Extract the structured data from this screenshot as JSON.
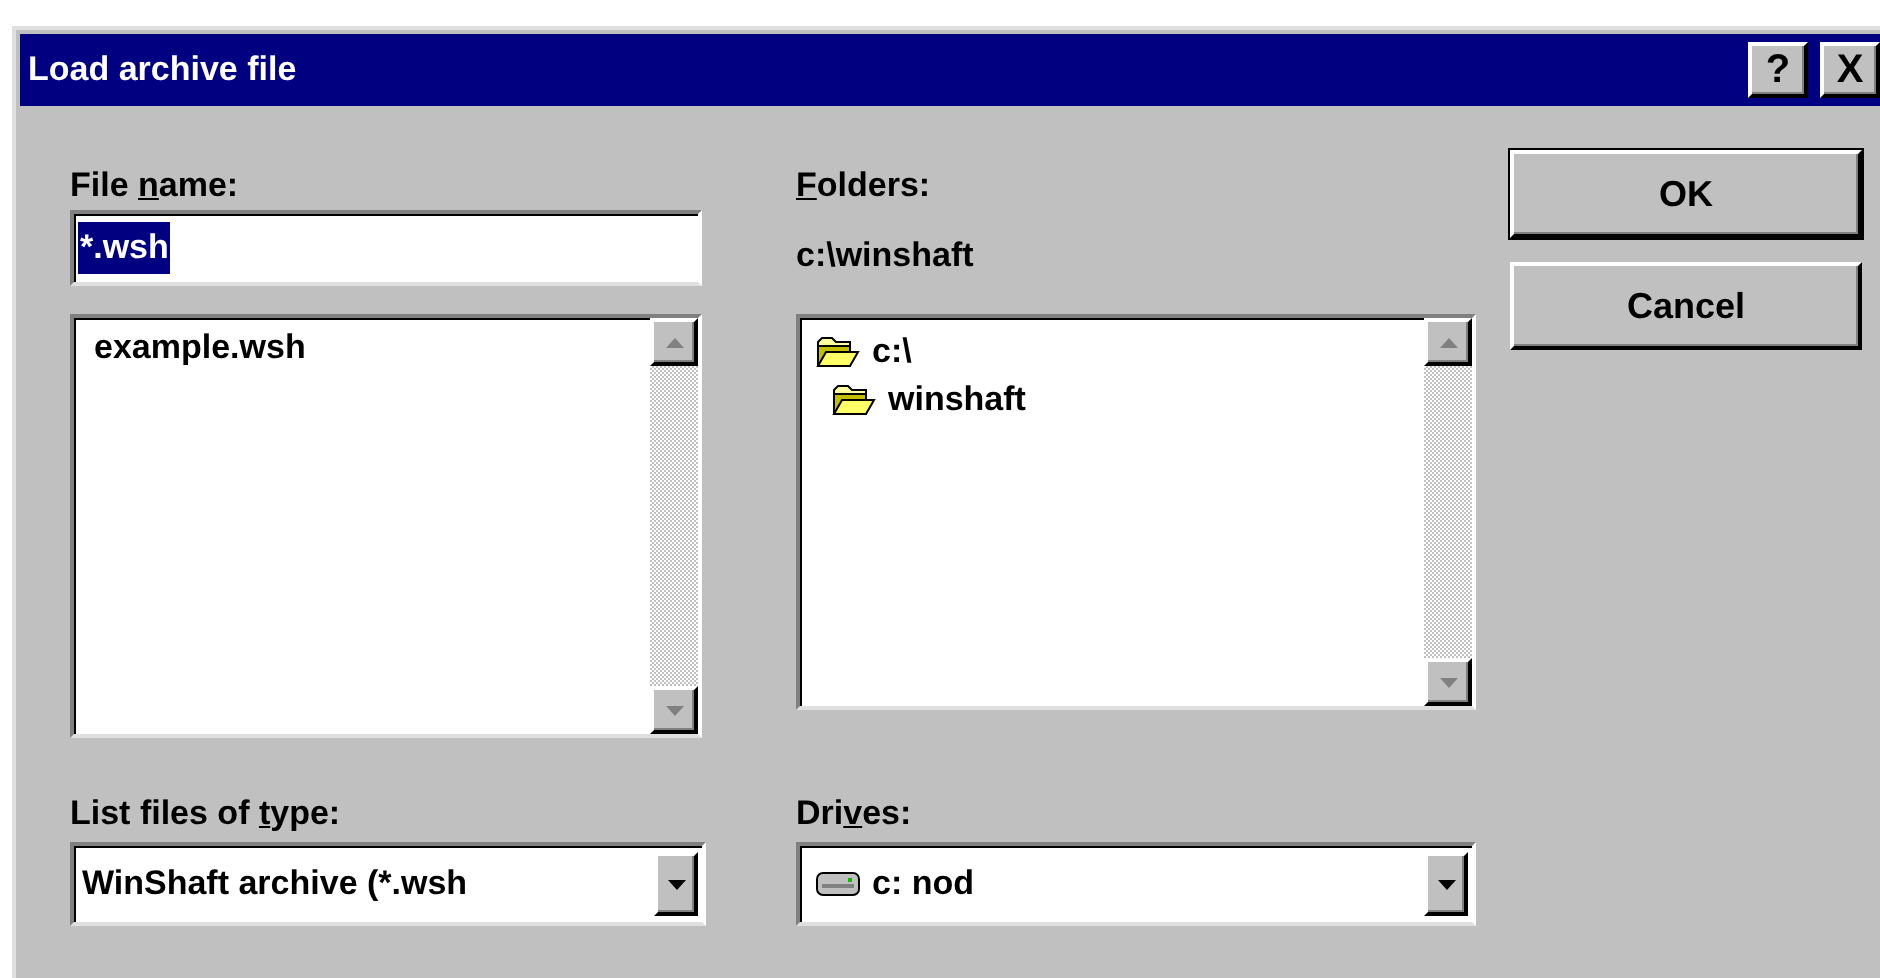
{
  "window": {
    "title": "Load archive file",
    "title_buttons": [
      {
        "kind": "help",
        "glyph": "?"
      },
      {
        "kind": "close",
        "glyph": "X"
      }
    ]
  },
  "file_name": {
    "label": {
      "pre": "File ",
      "key": "n",
      "post": "ame:"
    },
    "value": "*.wsh",
    "value_highlighted": true
  },
  "files": {
    "items": [
      {
        "name": "example.wsh"
      }
    ]
  },
  "folders": {
    "label": {
      "key": "F",
      "post": "olders:"
    },
    "path": "c:\\winshaft",
    "tree": [
      {
        "name": "c:\\",
        "children": [
          {
            "name": "winshaft"
          }
        ]
      }
    ]
  },
  "file_type": {
    "label": {
      "pre": "List files of ",
      "key": "t",
      "post": "ype:"
    },
    "value": "WinShaft archive (*.wsh"
  },
  "drives": {
    "label": {
      "pre": "Dri",
      "key": "v",
      "post": "es:"
    },
    "value": "c: nod"
  },
  "buttons": [
    {
      "label": "OK",
      "default": true
    },
    {
      "label": "Cancel",
      "default": false
    }
  ]
}
